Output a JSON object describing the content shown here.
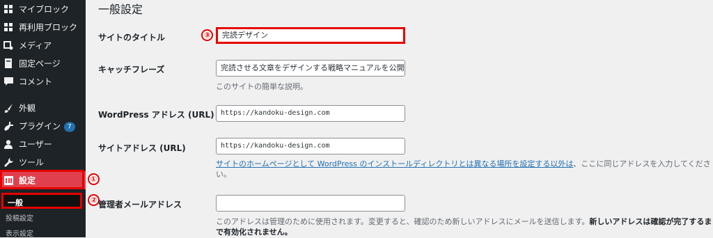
{
  "sidebar": {
    "items": [
      {
        "label": "マイブロック",
        "icon": "grid-icon"
      },
      {
        "label": "再利用ブロック",
        "icon": "grid-icon"
      },
      {
        "label": "メディア",
        "icon": "media-icon"
      },
      {
        "label": "固定ページ",
        "icon": "page-icon"
      },
      {
        "label": "コメント",
        "icon": "comment-icon"
      },
      {
        "label": "外観",
        "icon": "paintbrush-icon"
      },
      {
        "label": "プラグイン",
        "icon": "plugin-icon",
        "badge": "7"
      },
      {
        "label": "ユーザー",
        "icon": "user-icon"
      },
      {
        "label": "ツール",
        "icon": "wrench-icon"
      },
      {
        "label": "設定",
        "icon": "settings-icon",
        "active": true
      }
    ],
    "submenu": [
      "一般",
      "投稿設定",
      "表示設定"
    ]
  },
  "callouts": [
    "①",
    "②",
    "③"
  ],
  "main": {
    "title": "一般設定",
    "rows": {
      "site_title": {
        "label": "サイトのタイトル",
        "value": "完読デザイン"
      },
      "tagline": {
        "label": "キャッチフレーズ",
        "value": "完読させる文章をデザインする戦略マニュアルを公開",
        "desc": "このサイトの簡単な説明。"
      },
      "wp_address": {
        "label": "WordPress アドレス (URL)",
        "value": "https://kandoku-design.com"
      },
      "site_address": {
        "label": "サイトアドレス (URL)",
        "value": "https://kandoku-design.com",
        "desc_link": "サイトのホームページとして WordPress のインストールディレクトリとは異なる場所を設定する以外は",
        "desc_rest": "、ここに同じアドレスを入力してくださ",
        "desc_line2": "い。"
      },
      "admin_email": {
        "label": "管理者メールアドレス",
        "value": "",
        "desc": "このアドレスは管理のために使用されます。変更すると、確認のため新しいアドレスにメールを送信します。",
        "desc_bold": "新しいアドレスは確認が完了するま",
        "desc_line2_bold": "で有効化されません。"
      }
    }
  },
  "colors": {
    "sidebar_bg": "#1d2327",
    "active_bg": "#e0404d",
    "highlight": "#e60000",
    "link": "#2271b1"
  }
}
